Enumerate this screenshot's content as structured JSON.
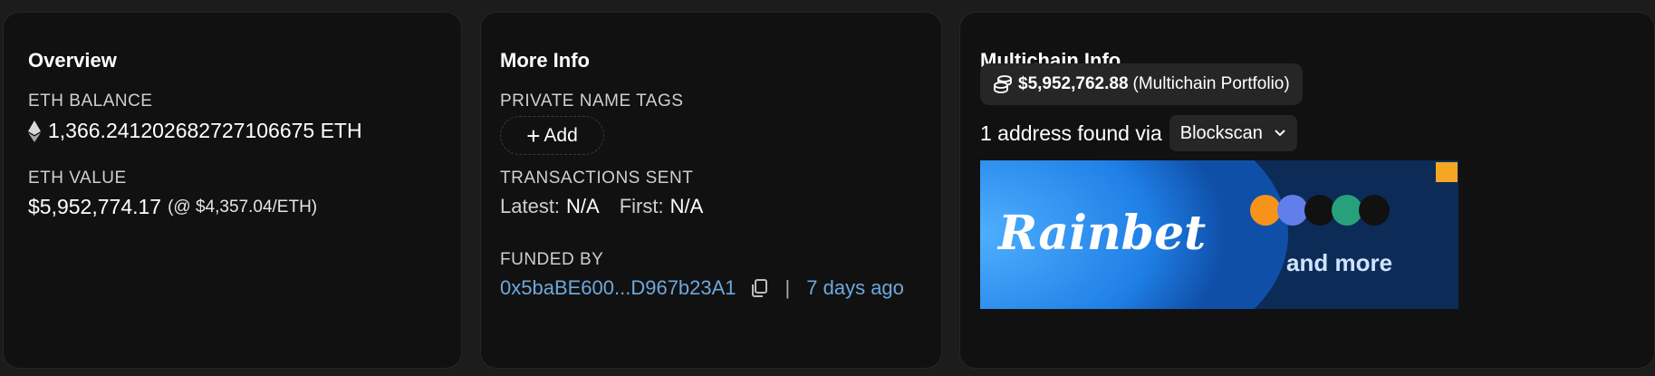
{
  "overview": {
    "title": "Overview",
    "eth_balance_label": "ETH BALANCE",
    "eth_balance_value": "1,366.241202682727106675 ETH",
    "eth_value_label": "ETH VALUE",
    "eth_value_amount": "$5,952,774.17",
    "eth_value_rate": "(@ $4,357.04/ETH)"
  },
  "more_info": {
    "title": "More Info",
    "private_tags_label": "PRIVATE NAME TAGS",
    "add_label": "Add",
    "tx_sent_label": "TRANSACTIONS SENT",
    "latest_label": "Latest:",
    "latest_value": "N/A",
    "first_label": "First:",
    "first_value": "N/A",
    "funded_by_label": "FUNDED BY",
    "funded_by_address": "0x5baBE600...D967b23A1",
    "funded_separator": "|",
    "funded_age": "7 days ago"
  },
  "multichain": {
    "title": "Multichain Info",
    "portfolio_amount": "$5,952,762.88",
    "portfolio_suffix": "(Multichain Portfolio)",
    "found_text": "1 address found via",
    "select_value": "Blockscan",
    "ad_brand": "Rainbet",
    "ad_tagline": "and more"
  },
  "colors": {
    "background": "#1c1c1c",
    "card": "#111111",
    "link": "#6ea8dc"
  }
}
